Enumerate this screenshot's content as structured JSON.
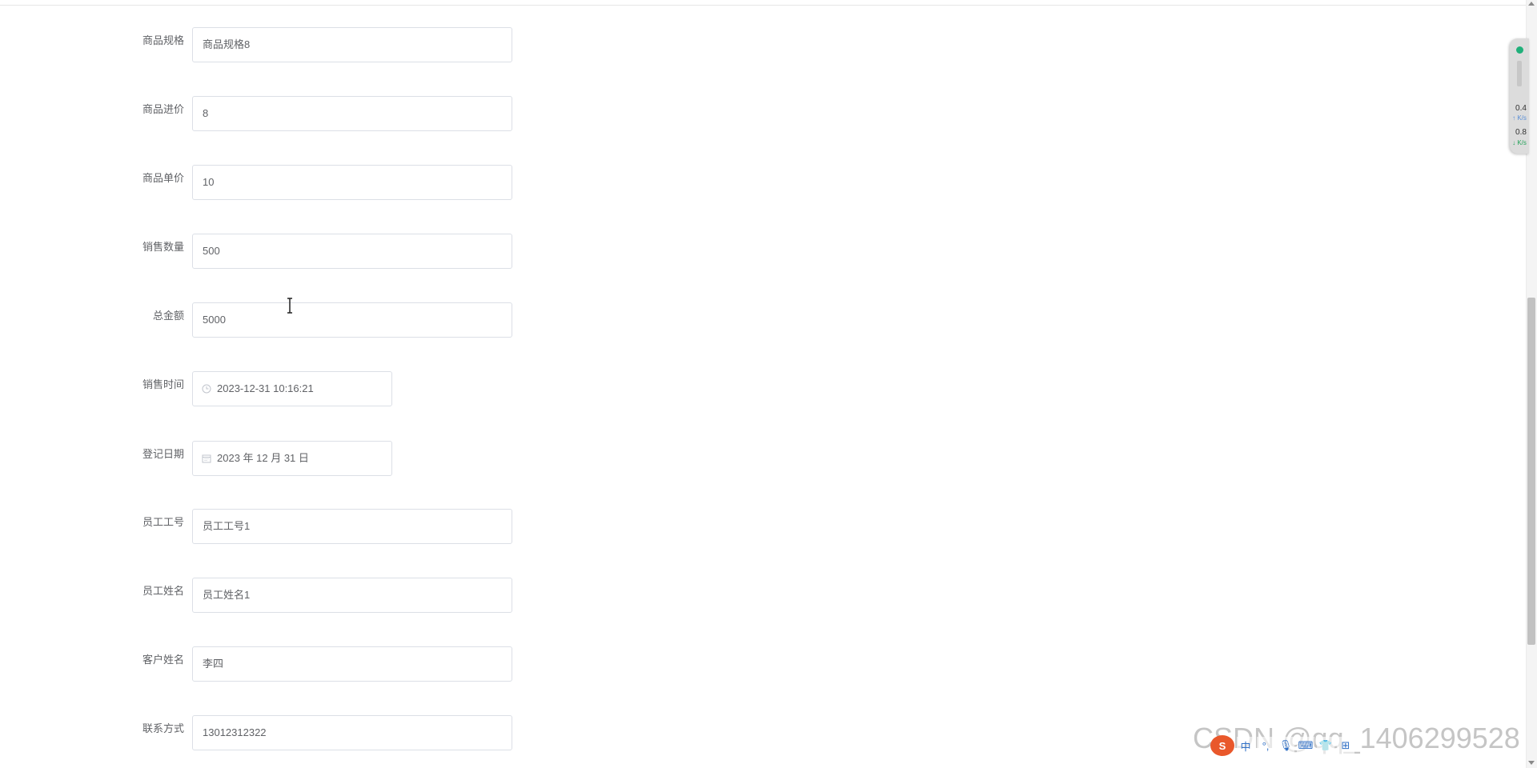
{
  "form": {
    "fields": [
      {
        "label": "商品规格",
        "value": "商品规格8"
      },
      {
        "label": "商品进价",
        "value": "8"
      },
      {
        "label": "商品单价",
        "value": "10"
      },
      {
        "label": "销售数量",
        "value": "500"
      },
      {
        "label": "总金额",
        "value": "5000"
      },
      {
        "label": "销售时间",
        "value": "2023-12-31 10:16:21"
      },
      {
        "label": "登记日期",
        "value": "2023 年 12 月 31 日"
      },
      {
        "label": "员工工号",
        "value": "员工工号1"
      },
      {
        "label": "员工姓名",
        "value": "员工姓名1"
      },
      {
        "label": "客户姓名",
        "value": "李四"
      },
      {
        "label": "联系方式",
        "value": "13012312322"
      }
    ]
  },
  "net_widget": {
    "upload_value": "0.4",
    "upload_unit": "K/s",
    "download_value": "0.8",
    "download_unit": "K/s"
  },
  "watermark": "CSDN @qq_1406299528",
  "ime": {
    "logo": "S",
    "buttons": [
      "中",
      "°,",
      "🎙",
      "⌨",
      "👕",
      "⊞"
    ]
  },
  "colors": {
    "border": "#dcdfe6",
    "text": "#606266",
    "icon": "#c0c4cc",
    "net_dot": "#20b07a",
    "ime_logo": "#e9582b"
  }
}
